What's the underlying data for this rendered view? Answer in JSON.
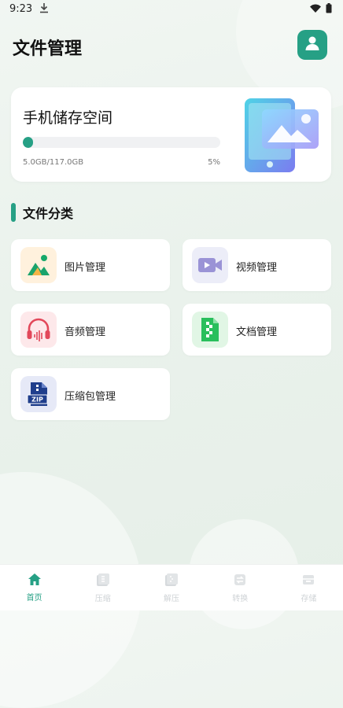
{
  "status": {
    "time": "9:23"
  },
  "header": {
    "title": "文件管理"
  },
  "storage": {
    "label": "手机储存空间",
    "used": "5.0GB",
    "total": "117.0GB",
    "usage_text": "5.0GB/117.0GB",
    "percent_text": "5%",
    "percent": 5
  },
  "section": {
    "title": "文件分类"
  },
  "categories": [
    {
      "label": "图片管理",
      "icon": "image-icon"
    },
    {
      "label": "视频管理",
      "icon": "video-icon"
    },
    {
      "label": "音频管理",
      "icon": "audio-icon"
    },
    {
      "label": "文档管理",
      "icon": "document-icon"
    },
    {
      "label": "压缩包管理",
      "icon": "zip-icon"
    }
  ],
  "tabs": [
    {
      "label": "首页",
      "icon": "home-icon",
      "active": true
    },
    {
      "label": "压缩",
      "icon": "compress-icon",
      "active": false
    },
    {
      "label": "解压",
      "icon": "extract-icon",
      "active": false
    },
    {
      "label": "转换",
      "icon": "convert-icon",
      "active": false
    },
    {
      "label": "存储",
      "icon": "storage-icon",
      "active": false
    }
  ],
  "colors": {
    "accent": "#26a085",
    "background": "#eaf2ec"
  }
}
